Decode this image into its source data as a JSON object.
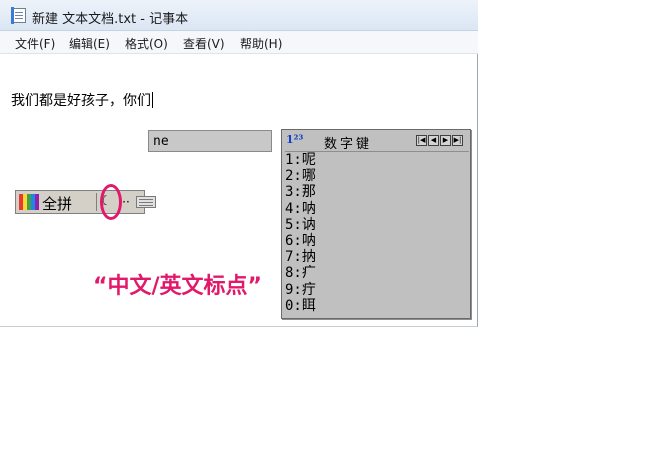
{
  "window": {
    "title": "新建 文本文档.txt - 记事本",
    "icon": "notepad-icon"
  },
  "menu": {
    "file": "文件(F)",
    "edit": "编辑(E)",
    "format": "格式(O)",
    "view": "查看(V)",
    "help": "帮助(H)"
  },
  "editor": {
    "text": "我们都是好孩子，你们"
  },
  "ime": {
    "composition": "ne",
    "candidate_window": {
      "icon_text": "1²³",
      "title": "数字键",
      "nav_buttons": [
        "|◀",
        "◀",
        "▶",
        "▶|"
      ],
      "candidates": [
        "1:呢",
        "2:哪",
        "3:那",
        "4:呐",
        "5:讷",
        "6:呐",
        "7:抐",
        "8:疒",
        "9:疔",
        "0:眲"
      ]
    },
    "status_bar": {
      "logo": "ime-logo-icon",
      "mode_label": "全拼",
      "width_icon": "half-moon-icon",
      "punct_icon": "punctuation-icon",
      "punct_glyph": "··",
      "keyboard_icon": "soft-keyboard-icon"
    }
  },
  "annotation": {
    "caption": "“中文/英文标点”",
    "color": "#e2186a"
  }
}
